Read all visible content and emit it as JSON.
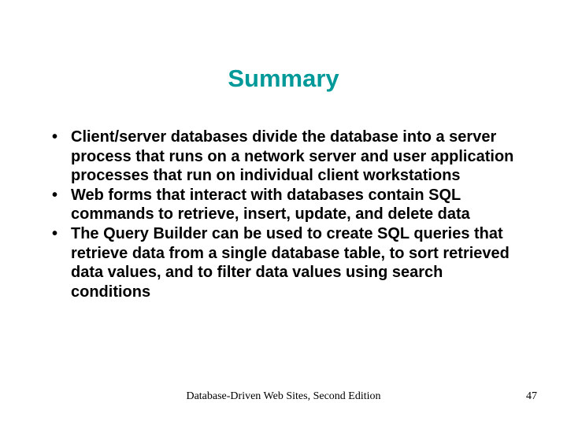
{
  "slide": {
    "title": "Summary",
    "bullets": [
      "Client/server databases divide the database into a server process that runs on a network server and user application processes that run on individual client workstations",
      "Web forms that interact with databases contain SQL commands to retrieve, insert, update, and delete data",
      "The Query Builder can be used to create SQL queries that retrieve data from a single database table, to sort retrieved data values, and to filter data values using search conditions"
    ],
    "footer_center": "Database-Driven Web Sites, Second Edition",
    "page_number": "47"
  }
}
